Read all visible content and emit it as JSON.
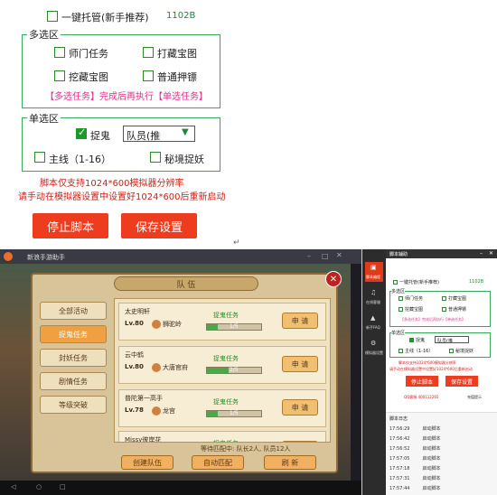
{
  "top": {
    "one_click_label": "一键托管(新手推荐)",
    "version": "1102B",
    "multi_legend": "多选区",
    "multi_items": [
      "师门任务",
      "打藏宝图",
      "挖藏宝图",
      "普通押镖"
    ],
    "multi_note": "【多选任务】完成后再执行【单选任务】",
    "single_legend": "单选区",
    "catch_ghost_label": "捉鬼",
    "role_select": "队员(推",
    "main_line_label": "主线（1-16）",
    "secret_label": "秘境捉妖",
    "warn1": "脚本仅支持1024*600模拟器分辨率",
    "warn2": "请手动在模拟器设置中设置好1024*600后重新启动",
    "stop_btn": "停止脚本",
    "save_btn": "保存设置",
    "caret": "↵"
  },
  "emulator": {
    "title": "新浪手游助手",
    "dialog_title": "队 伍",
    "tabs": [
      "全部活动",
      "捉鬼任务",
      "封妖任务",
      "剧情任务",
      "等级突破"
    ],
    "rows": [
      {
        "name": "太史明轩",
        "level": "Lv.80",
        "school": "狮驼岭",
        "task": "捉鬼任务",
        "progress": "1/5",
        "progress_value": 0.2,
        "btn": "申 请"
      },
      {
        "name": "云中鹤",
        "level": "Lv.80",
        "school": "大唐官府",
        "task": "捉鬼任务",
        "progress": "2/5",
        "progress_value": 0.4,
        "btn": "申 请"
      },
      {
        "name": "普陀第一高手",
        "level": "Lv.78",
        "school": "龙宫",
        "task": "捉鬼任务",
        "progress": "1/5",
        "progress_value": 0.2,
        "btn": "申 请"
      },
      {
        "name": "Missy彼岸花",
        "level": "",
        "school": "",
        "task": "捉鬼任务",
        "progress": "",
        "progress_value": 0,
        "btn": "申 请"
      }
    ],
    "wait_text": "等待匹配中: 队长2人, 队员12人",
    "create_btn": "创建队伍",
    "auto_btn": "自动匹配",
    "refresh_btn": "刷 新",
    "close_glyph": "✕"
  },
  "helper": {
    "title": "脚本辅助",
    "side_items": [
      "脚本编程",
      "在线客服",
      "新手FAQ",
      "模拟器设置"
    ],
    "log_title": "脚本日志",
    "stop_btn": "停止脚本",
    "save_btn": "保存设置",
    "qq_text": "QQ客服 400112265",
    "sound_text": "充值提示",
    "logs": [
      {
        "time": "17:56:29",
        "msg": "启动脚本"
      },
      {
        "time": "17:56:42",
        "msg": "启动脚本"
      },
      {
        "time": "17:56:52",
        "msg": "启动脚本"
      },
      {
        "time": "17:57:05",
        "msg": "启动脚本"
      },
      {
        "time": "17:57:18",
        "msg": "启动脚本"
      },
      {
        "time": "17:57:31",
        "msg": "启动脚本"
      },
      {
        "time": "17:57:44",
        "msg": "启动脚本"
      }
    ]
  },
  "colors": {
    "green_border": "#3aa85a",
    "red_button": "#ee3c1f",
    "note_pink": "#e0308a",
    "warn_red": "#d0201a"
  }
}
